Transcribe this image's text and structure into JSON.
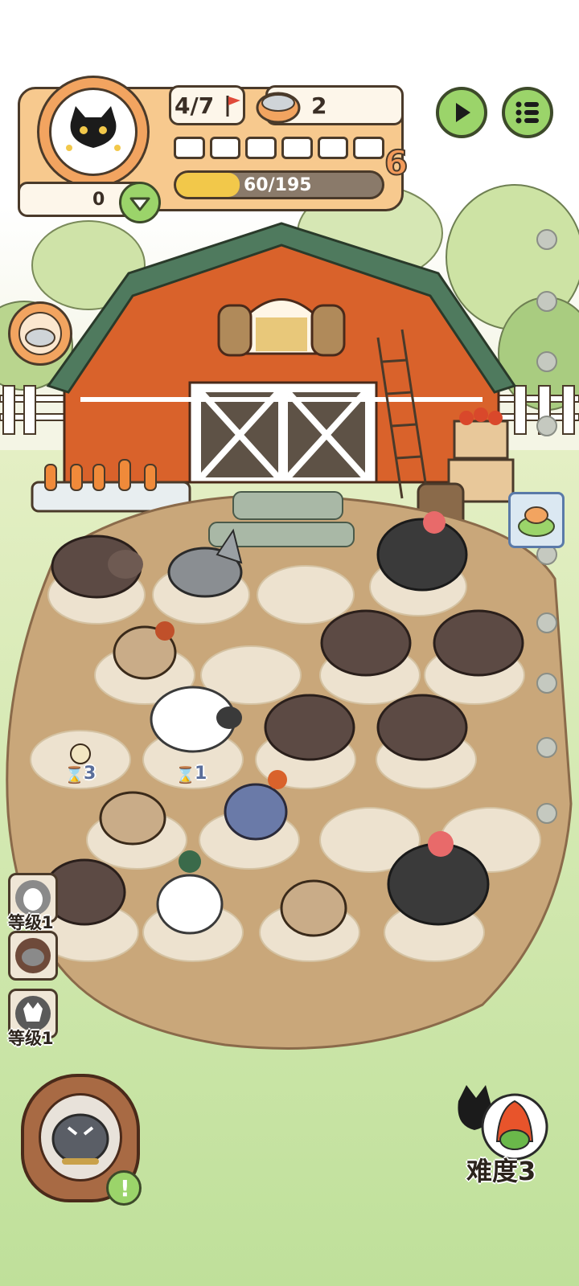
{
  "hud": {
    "avatar": "black-cat-avatar",
    "score": "0",
    "wave": {
      "current": 4,
      "total": 7,
      "label": "4/7"
    },
    "food_count": "2",
    "level_number": "6",
    "xp": {
      "current": 60,
      "max": 195,
      "label": "60/195"
    },
    "segment_count": 6
  },
  "buttons": {
    "play_icon": "play-icon",
    "menu_icon": "menu-list-icon"
  },
  "side_skills": [
    {
      "level_label": "等级1"
    },
    {
      "level_label": ""
    },
    {
      "level_label": "等级1"
    }
  ],
  "field": {
    "timers": [
      {
        "value": "3"
      },
      {
        "value": "1"
      }
    ],
    "difficulty_label": "难度3"
  },
  "colors": {
    "hud_border": "#4a3a2a",
    "hud_bg": "#fdf6ea",
    "orange": "#f2a460",
    "green_button": "#9bd46a",
    "xp_fill": "#f2c84a",
    "barn_red": "#d9622b",
    "dirt": "#c9a77a",
    "grass": "#cfe6a8"
  }
}
